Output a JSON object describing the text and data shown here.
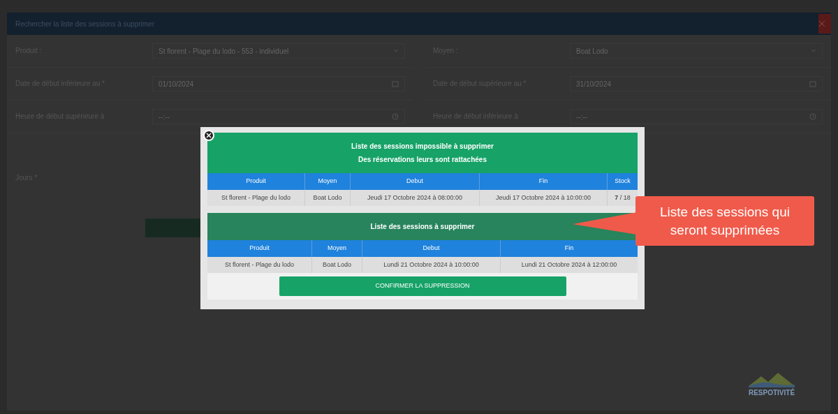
{
  "background_form": {
    "title": "Rechercher la liste des sessions à supprimer",
    "rows": [
      {
        "left": {
          "label": "Produit :",
          "value": "St florent - Plage du lodo - 553 - individuel",
          "kind": "select"
        },
        "right": {
          "label": "Moyen :",
          "value": "Boat Lodo",
          "kind": "select"
        }
      },
      {
        "left": {
          "label": "Date de début inférieure au *",
          "value": "01/10/2024",
          "kind": "date"
        },
        "right": {
          "label": "Date de début supérieure au *",
          "value": "31/10/2024",
          "kind": "date"
        }
      },
      {
        "left": {
          "label": "Heure de début supérieure à",
          "value": "--:--",
          "kind": "time"
        },
        "right": {
          "label": "Heure de début inférieure à",
          "value": "--:--",
          "kind": "time"
        }
      }
    ],
    "jours_label": "Jours *"
  },
  "modal": {
    "sections": [
      {
        "titles": [
          "Liste des sessions impossible à supprimer",
          "Des réservations leurs sont rattachées"
        ],
        "color": "#17a267",
        "columns": [
          "Produit",
          "Moyen",
          "Debut",
          "Fin",
          "Stock"
        ],
        "rows": [
          [
            "St florent - Plage du lodo",
            "Boat Lodo",
            "Jeudi 17 Octobre 2024 à 08:00:00",
            "Jeudi 17 Octobre 2024 à 10:00:00",
            "**7** / 18"
          ]
        ]
      },
      {
        "titles": [
          "Liste des sessions à supprimer"
        ],
        "color": "#27845c",
        "columns": [
          "Produit",
          "Moyen",
          "Debut",
          "Fin"
        ],
        "rows": [
          [
            "St florent - Plage du lodo",
            "Boat Lodo",
            "Lundi 21 Octobre 2024 à 10:00:00",
            "Lundi 21 Octobre 2024 à 12:00:00"
          ]
        ]
      }
    ],
    "confirm_button": "CONFIRMER LA SUPPRESSION"
  },
  "callout": "Liste des sessions qui seront supprimées",
  "logo": "RESPOTIVITÉ"
}
